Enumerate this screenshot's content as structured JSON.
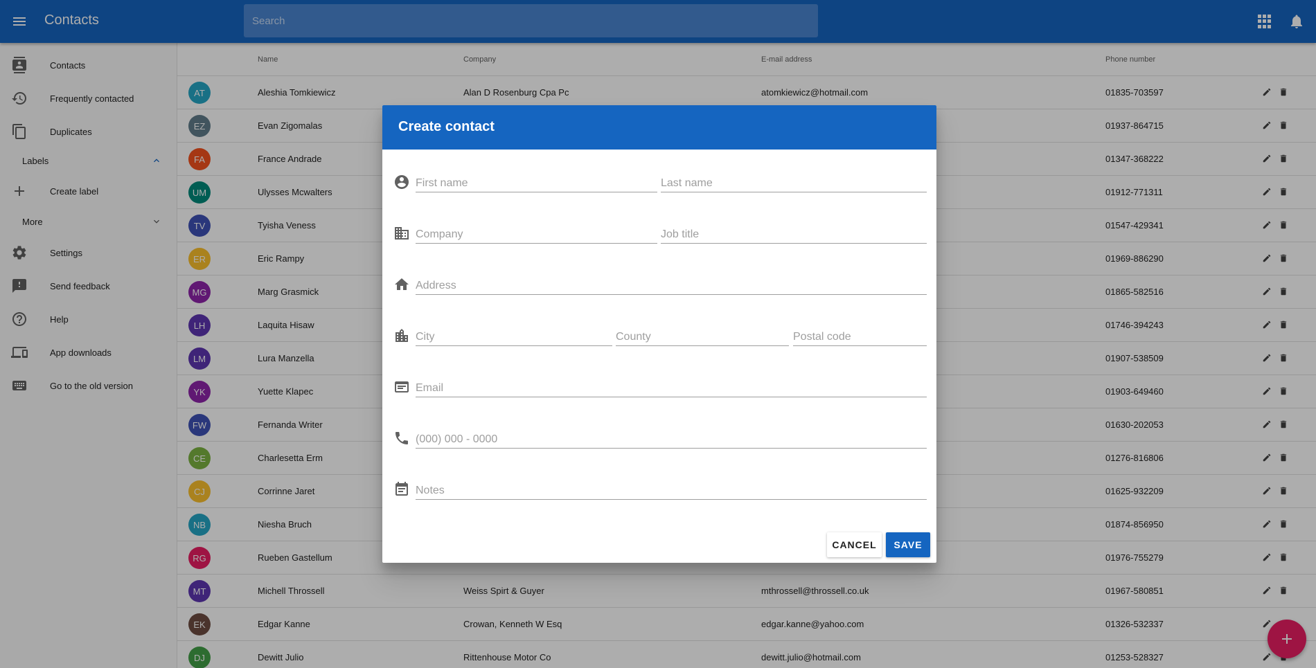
{
  "app": {
    "title": "Contacts"
  },
  "search": {
    "placeholder": "Search"
  },
  "sidebar": {
    "items": [
      {
        "label": "Contacts",
        "icon": "contacts-icon"
      },
      {
        "label": "Frequently contacted",
        "icon": "history-icon"
      },
      {
        "label": "Duplicates",
        "icon": "copy-icon"
      }
    ],
    "labels_header": "Labels",
    "create_label": "Create label",
    "more_header": "More",
    "bottom_items": [
      {
        "label": "Settings",
        "icon": "gear-icon"
      },
      {
        "label": "Send feedback",
        "icon": "feedback-icon"
      },
      {
        "label": "Help",
        "icon": "help-icon"
      },
      {
        "label": "App downloads",
        "icon": "devices-icon"
      },
      {
        "label": "Go to the old version",
        "icon": "keyboard-icon"
      }
    ]
  },
  "table": {
    "headers": {
      "name": "Name",
      "company": "Company",
      "email": "E-mail address",
      "phone": "Phone number"
    },
    "rows": [
      {
        "initials": "AT",
        "color": "#26a6c4",
        "name": "Aleshia Tomkiewicz",
        "company": "Alan D Rosenburg Cpa Pc",
        "email": "atomkiewicz@hotmail.com",
        "phone": "01835-703597"
      },
      {
        "initials": "EZ",
        "color": "#607d8b",
        "name": "Evan Zigomalas",
        "company": "",
        "email": "",
        "phone": "01937-864715"
      },
      {
        "initials": "FA",
        "color": "#f4511e",
        "name": "France Andrade",
        "company": "",
        "email": "",
        "phone": "01347-368222"
      },
      {
        "initials": "UM",
        "color": "#00897b",
        "name": "Ulysses Mcwalters",
        "company": "",
        "email": "",
        "phone": "01912-771311"
      },
      {
        "initials": "TV",
        "color": "#3f51b5",
        "name": "Tyisha Veness",
        "company": "",
        "email": "",
        "phone": "01547-429341"
      },
      {
        "initials": "ER",
        "color": "#fbc02d",
        "name": "Eric Rampy",
        "company": "",
        "email": "",
        "phone": "01969-886290"
      },
      {
        "initials": "MG",
        "color": "#8e24aa",
        "name": "Marg Grasmick",
        "company": "",
        "email": "",
        "phone": "01865-582516"
      },
      {
        "initials": "LH",
        "color": "#5e35b1",
        "name": "Laquita Hisaw",
        "company": "",
        "email": "",
        "phone": "01746-394243"
      },
      {
        "initials": "LM",
        "color": "#5e35b1",
        "name": "Lura Manzella",
        "company": "",
        "email": "",
        "phone": "01907-538509"
      },
      {
        "initials": "YK",
        "color": "#8e24aa",
        "name": "Yuette Klapec",
        "company": "",
        "email": "",
        "phone": "01903-649460"
      },
      {
        "initials": "FW",
        "color": "#3f51b5",
        "name": "Fernanda Writer",
        "company": "",
        "email": "",
        "phone": "01630-202053"
      },
      {
        "initials": "CE",
        "color": "#7cb342",
        "name": "Charlesetta Erm",
        "company": "",
        "email": "",
        "phone": "01276-816806"
      },
      {
        "initials": "CJ",
        "color": "#fbc02d",
        "name": "Corrinne Jaret",
        "company": "",
        "email": "",
        "phone": "01625-932209"
      },
      {
        "initials": "NB",
        "color": "#26a6c4",
        "name": "Niesha Bruch",
        "company": "",
        "email": "",
        "phone": "01874-856950"
      },
      {
        "initials": "RG",
        "color": "#e91e63",
        "name": "Rueben Gastellum",
        "company": "",
        "email": "",
        "phone": "01976-755279"
      },
      {
        "initials": "MT",
        "color": "#5e35b1",
        "name": "Michell Throssell",
        "company": "Weiss Spirt & Guyer",
        "email": "mthrossell@throssell.co.uk",
        "phone": "01967-580851"
      },
      {
        "initials": "EK",
        "color": "#6d4c41",
        "name": "Edgar Kanne",
        "company": "Crowan, Kenneth W Esq",
        "email": "edgar.kanne@yahoo.com",
        "phone": "01326-532337"
      },
      {
        "initials": "DJ",
        "color": "#43a047",
        "name": "Dewitt Julio",
        "company": "Rittenhouse Motor Co",
        "email": "dewitt.julio@hotmail.com",
        "phone": "01253-528327"
      }
    ]
  },
  "dialog": {
    "title": "Create contact",
    "fields": {
      "first_name": "First name",
      "last_name": "Last name",
      "company": "Company",
      "job_title": "Job title",
      "address": "Address",
      "city": "City",
      "county": "County",
      "postal_code": "Postal code",
      "email": "Email",
      "phone": "(000) 000 - 0000",
      "notes": "Notes"
    },
    "cancel_label": "CANCEL",
    "save_label": "SAVE"
  },
  "fab": {
    "icon": "add-icon"
  }
}
